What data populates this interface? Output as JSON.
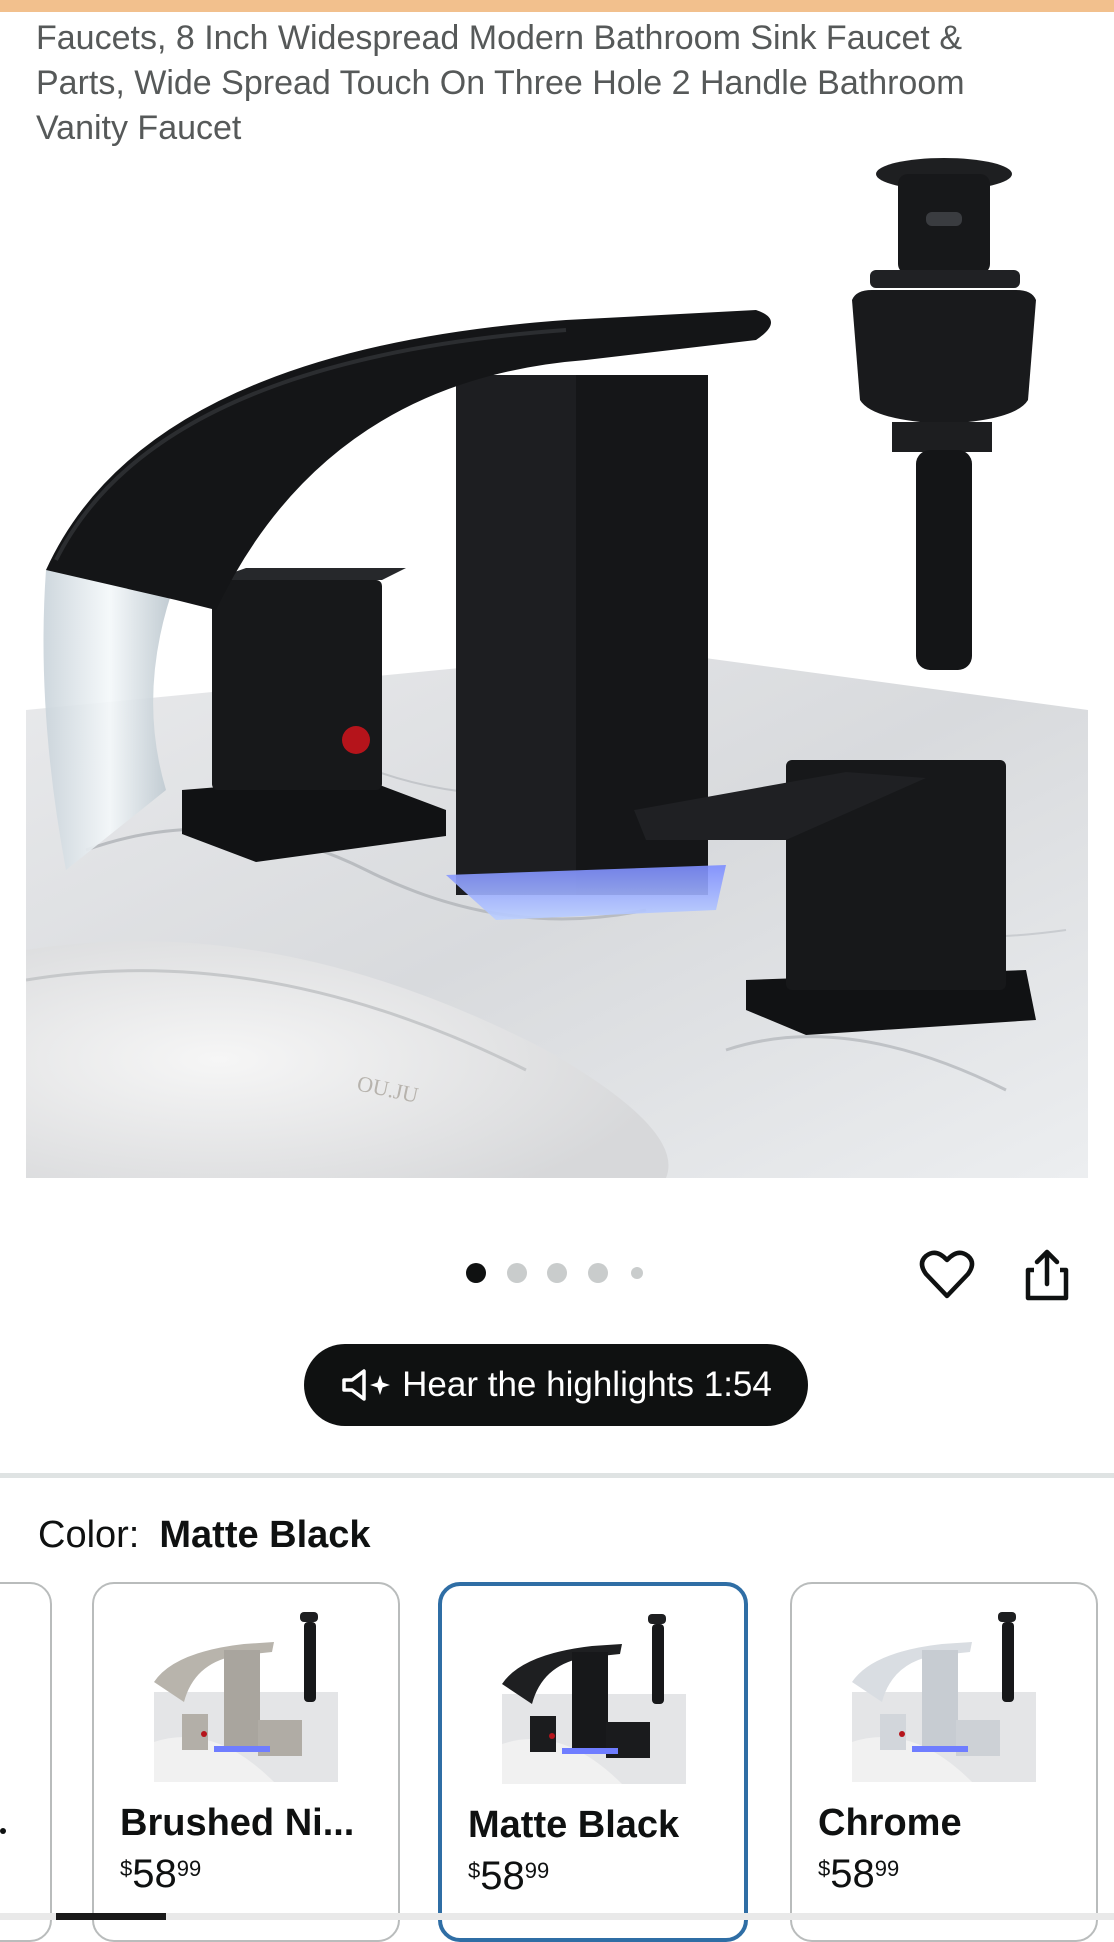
{
  "product": {
    "title": "Faucets, 8 Inch Widespread Modern Bathroom Sink Faucet & Parts, Wide Spread Touch On Three Hole 2 Handle Bathroom Vanity Faucet",
    "image_watermark": "OU.JU"
  },
  "gallery": {
    "image_count": 5,
    "active_index": 0
  },
  "actions": {
    "wishlist_icon": "heart-icon",
    "share_icon": "share-icon"
  },
  "audio": {
    "label": "Hear the highlights 1:54",
    "icon": "speaker-sparkle-icon"
  },
  "color": {
    "label": "Color:",
    "selected": "Matte Black",
    "options": [
      {
        "name": "Brushed Ni...",
        "price_currency": "$",
        "price_whole": "58",
        "price_fraction": "99",
        "finish": "#b8b4ac"
      },
      {
        "name": "Matte Black",
        "price_currency": "$",
        "price_whole": "58",
        "price_fraction": "99",
        "finish": "#1e1f21"
      },
      {
        "name": "Chrome",
        "price_currency": "$",
        "price_whole": "58",
        "price_fraction": "99",
        "finish": "#d9dde2"
      }
    ]
  },
  "colors": {
    "accent_border": "#2f6ea5",
    "top_bar": "#f2c08d",
    "audio_pill": "#0f1111"
  }
}
